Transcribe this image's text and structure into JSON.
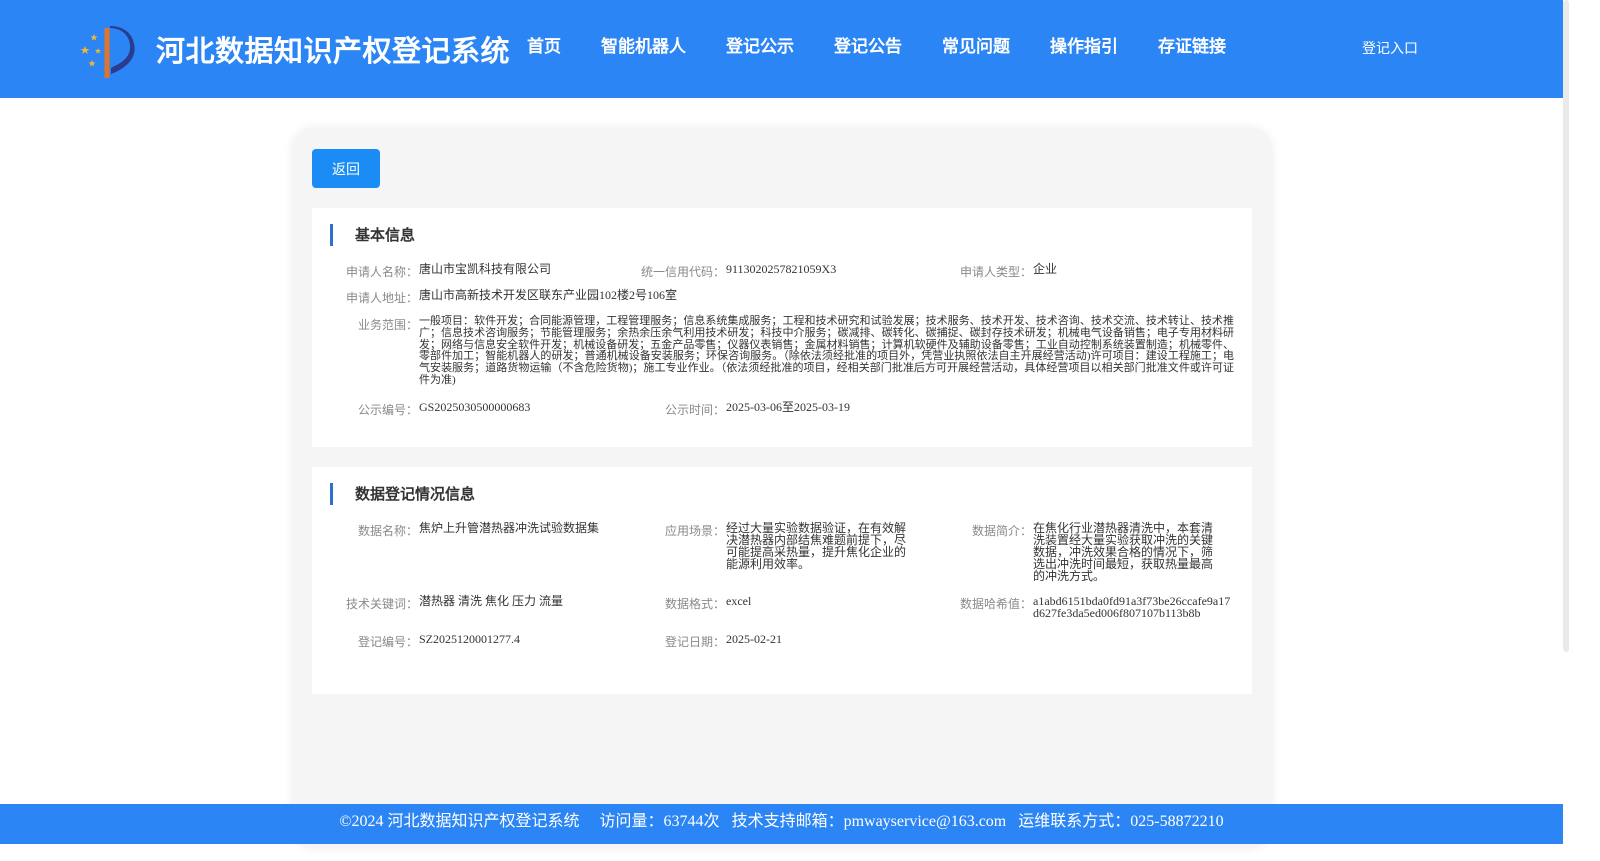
{
  "header": {
    "title": "河北数据知识产权登记系统",
    "nav": [
      "首页",
      "智能机器人",
      "登记公示",
      "登记公告",
      "常见问题",
      "操作指引",
      "存证链接"
    ],
    "login": "登记入口"
  },
  "back_button": "返回",
  "basic_info": {
    "title": "基本信息",
    "applicant_name_label": "申请人名称：",
    "applicant_name": "唐山市宝凯科技有限公司",
    "credit_code_label": "统一信用代码：",
    "credit_code": "9113020257821059X3",
    "applicant_type_label": "申请人类型：",
    "applicant_type": "企业",
    "address_label": "申请人地址：",
    "address": "唐山市高新技术开发区联东产业园102楼2号106室",
    "scope_label": "业务范围：",
    "scope": "一般项目：软件开发；合同能源管理，工程管理服务；信息系统集成服务；工程和技术研究和试验发展；技术服务、技术开发、技术咨询、技术交流、技术转让、技术推广；信息技术咨询服务；节能管理服务；余热余压余气利用技术研发；科技中介服务；碳减排、碳转化、碳捕捉、碳封存技术研发；机械电气设备销售；电子专用材料研发；网络与信息安全软件开发；机械设备研发；五金产品零售；仪器仪表销售；金属材料销售；计算机软硬件及辅助设备零售；工业自动控制系统装置制造；机械零件、零部件加工；智能机器人的研发；普通机械设备安装服务；环保咨询服务。（除依法须经批准的项目外，凭营业执照依法自主开展经营活动)许可项目：建设工程施工；电气安装服务；道路货物运输（不含危险货物)；施工专业作业。（依法须经批准的项目，经相关部门批准后方可开展经营活动，具体经营项目以相关部门批准文件或许可证件为准)",
    "notice_no_label": "公示编号：",
    "notice_no": "GS2025030500000683",
    "notice_time_label": "公示时间：",
    "notice_time": "2025-03-06至2025-03-19"
  },
  "data_info": {
    "title": "数据登记情况信息",
    "data_name_label": "数据名称：",
    "data_name": "焦炉上升管潜热器冲洗试验数据集",
    "scenario_label": "应用场景：",
    "scenario": "经过大量实验数据验证，在有效解决潜热器内部结焦难题前提下，尽可能提高采热量，提升焦化企业的能源利用效率。",
    "intro_label": "数据简介：",
    "intro": "在焦化行业潜热器清洗中，本套清洗装置经大量实验获取冲洗的关键数据，冲洗效果合格的情况下，筛选出冲洗时间最短，获取热量最高的冲洗方式。",
    "keywords_label": "技术关键词：",
    "keywords": "潜热器 清洗 焦化 压力 流量",
    "format_label": "数据格式：",
    "format": "excel",
    "hash_label": "数据哈希值：",
    "hash": "a1abd6151bda0fd91a3f73be26ccafe9a17d627fe3da5ed006f807107b113b8b",
    "reg_no_label": "登记编号：",
    "reg_no": "SZ2025120001277.4",
    "reg_date_label": "登记日期：",
    "reg_date": "2025-02-21"
  },
  "footer": {
    "copyright": "©2024 河北数据知识产权登记系统",
    "visits": "访问量：63744次",
    "email": "技术支持邮箱：pmwayservice@163.com",
    "phone": "运维联系方式：025-58872210"
  },
  "colors": {
    "brand_blue": "#2b85f5",
    "button_blue": "#1b8cf5",
    "section_bar": "#2c71d0"
  }
}
